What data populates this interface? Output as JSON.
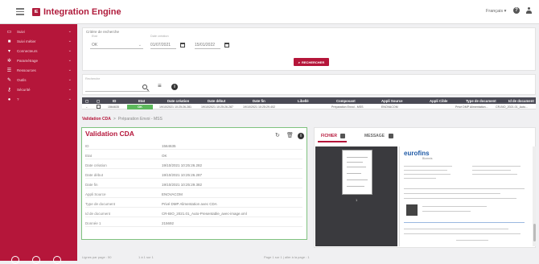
{
  "app": {
    "logo_text": "IE",
    "title": "Integration Engine",
    "language": "Français ▾"
  },
  "sidebar": {
    "items": [
      {
        "label": "Suivi",
        "icon": "monitor-icon"
      },
      {
        "label": "Suivi métier",
        "icon": "briefcase-icon"
      },
      {
        "label": "Connecteurs",
        "icon": "plug-icon"
      },
      {
        "label": "Paramétrage",
        "icon": "gear-icon"
      },
      {
        "label": "Ressources",
        "icon": "list-icon"
      },
      {
        "label": "Outils",
        "icon": "wrench-icon"
      },
      {
        "label": "Sécurité",
        "icon": "key-icon"
      },
      {
        "label": "?",
        "icon": "help-icon"
      }
    ]
  },
  "criteria": {
    "title": "Critère de recherche",
    "etat_label": "Etat",
    "etat_value": "OK",
    "date_label": "Date création",
    "date_from": "01/07/2021",
    "date_to": "15/01/2022",
    "search_button": "RECHERCHER"
  },
  "search": {
    "label": "Recherche"
  },
  "table": {
    "headers": [
      "ID",
      "Etat",
      "Date création",
      "Date début",
      "Date fin",
      "Libellé",
      "Composant",
      "Appli Source",
      "Appli Cible",
      "Type de document",
      "Id de document"
    ],
    "row": {
      "id": "1564635",
      "etat": "OK",
      "created": "19/10/2021 10:25:26.281",
      "start": "19/10/2021 10:25:26.287",
      "end": "19/10/2021 10:25:29.402",
      "composant": "Préparation Envoi - MSS",
      "source": "ENOVACOM",
      "doc_type": "Privé DMP Alimentation...",
      "doc_id": "CR-BIO_2021.01_Auto..."
    }
  },
  "breadcrumb": {
    "root": "Validation CDA",
    "sep": ">",
    "current": "Préparation Envoi - MSS"
  },
  "detail": {
    "title": "Validation CDA",
    "rows": [
      {
        "k": "ID",
        "v": "1564635"
      },
      {
        "k": "Etat",
        "v": "OK"
      },
      {
        "k": "Date création",
        "v": "19/10/2021 10:25:26.282"
      },
      {
        "k": "Date début",
        "v": "19/10/2021 10:25:26.287"
      },
      {
        "k": "Date fin",
        "v": "19/10/2021 10:25:29.382"
      },
      {
        "k": "Appli Source",
        "v": "ENOVACOM"
      },
      {
        "k": "Type de document",
        "v": "Privé DMP Alimentation avec CDA"
      },
      {
        "k": "Id de document",
        "v": "CR-BIO_2021.01_Auto-Presentable_avec-image.xml"
      },
      {
        "k": "Donnée 1",
        "v": "215692"
      }
    ]
  },
  "viewer": {
    "tab_file": "FICHIER",
    "tab_message": "MESSAGE",
    "page_number": "1",
    "brand": "eurofins",
    "brand_sub": "Biomnis"
  },
  "footer": {
    "left": "Lignes par page : 50",
    "range": "1 à 1 sur 1",
    "center": "Page 1 sur 1 | aller à la page : 1"
  }
}
